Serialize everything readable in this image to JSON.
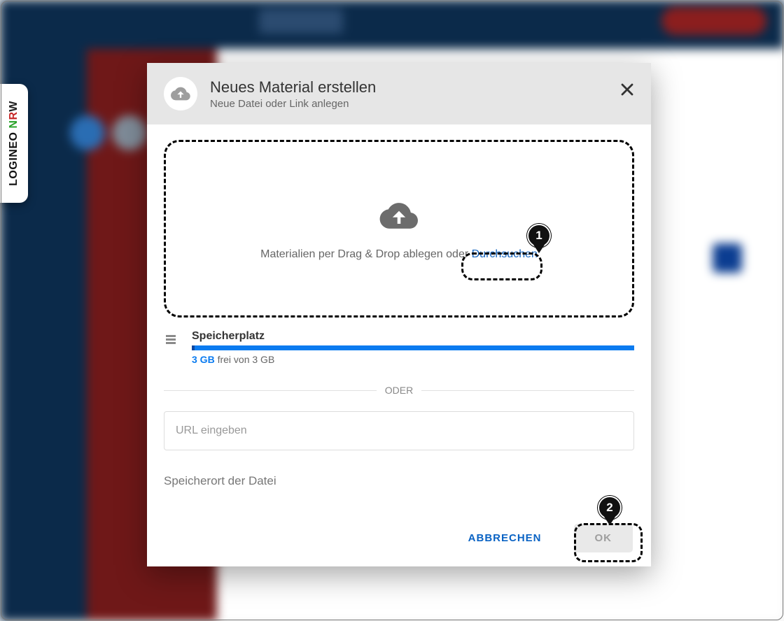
{
  "sideTab": {
    "p1": "LOGINEO",
    "p2": "N",
    "p3": "R",
    "p4": "W"
  },
  "dialog": {
    "title": "Neues Material erstellen",
    "subtitle": "Neue Datei oder Link anlegen",
    "dropzone": {
      "text_prefix": "Materialien per Drag & Drop ablegen oder ",
      "browse": "Durchsuchen"
    },
    "storage": {
      "label": "Speicherplatz",
      "free_amount": "3 GB",
      "free_suffix": " frei von 3 GB"
    },
    "divider": "ODER",
    "url_placeholder": "URL eingeben",
    "location_label": "Speicherort der Datei",
    "buttons": {
      "cancel": "ABBRECHEN",
      "ok": "OK"
    }
  },
  "markers": {
    "m1": "1",
    "m2": "2"
  }
}
